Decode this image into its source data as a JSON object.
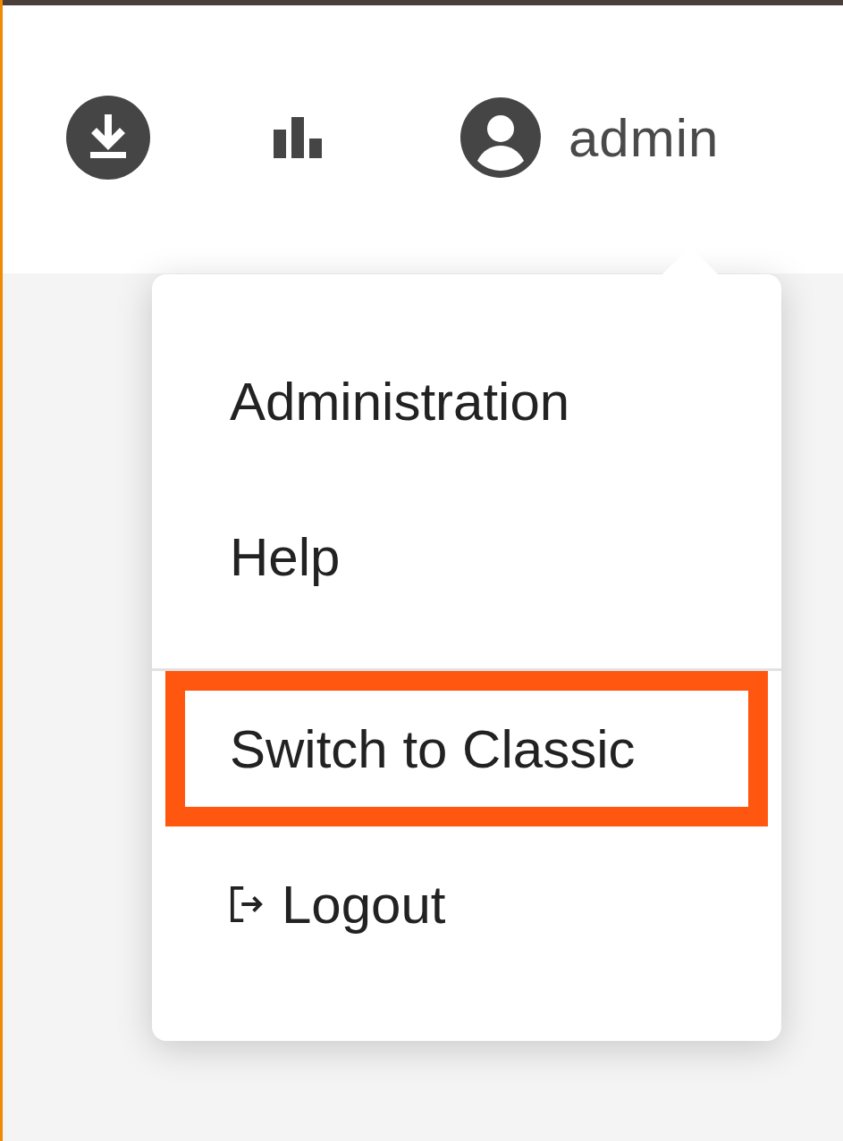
{
  "user": {
    "name": "admin"
  },
  "menu": {
    "items": [
      {
        "kind": "plain",
        "label": "Administration",
        "highlighted": false
      },
      {
        "kind": "plain",
        "label": "Help",
        "highlighted": false
      },
      {
        "kind": "divider"
      },
      {
        "kind": "plain",
        "label": "Switch to Classic",
        "highlighted": true
      },
      {
        "kind": "logout",
        "label": "Logout",
        "highlighted": false
      }
    ]
  }
}
